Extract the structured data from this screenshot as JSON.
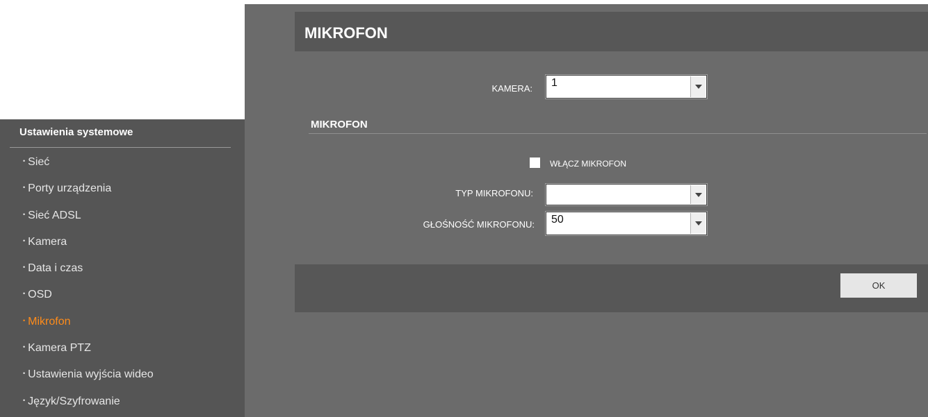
{
  "sidebar": {
    "title": "Ustawienia systemowe",
    "items": [
      {
        "label": "Sieć",
        "active": false
      },
      {
        "label": "Porty urządzenia",
        "active": false
      },
      {
        "label": "Sieć ADSL",
        "active": false
      },
      {
        "label": "Kamera",
        "active": false
      },
      {
        "label": "Data i czas",
        "active": false
      },
      {
        "label": "OSD",
        "active": false
      },
      {
        "label": "Mikrofon",
        "active": true
      },
      {
        "label": "Kamera PTZ",
        "active": false
      },
      {
        "label": "Ustawienia wyjścia wideo",
        "active": false
      },
      {
        "label": "Język/Szyfrowanie",
        "active": false
      }
    ],
    "bullet": "•",
    "active_color": "#ff8c1a"
  },
  "header": {
    "title": "MIKROFON"
  },
  "form": {
    "camera_label": "KAMERA:",
    "camera_value": "1",
    "section_title": "MIKROFON",
    "enable_label": "WŁĄCZ MIKROFON",
    "enable_checked": false,
    "type_label": "TYP MIKROFONU:",
    "type_value": "",
    "volume_label": "GŁOŚNOŚĆ MIKROFONU:",
    "volume_value": "50"
  },
  "footer": {
    "ok_label": "OK"
  },
  "icons": {
    "dropdown": "chevron-down-icon",
    "checkbox": "checkbox-icon"
  }
}
